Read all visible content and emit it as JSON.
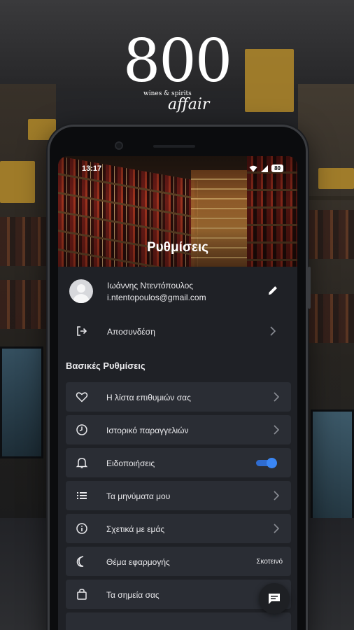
{
  "logo": {
    "number": "800",
    "subtitle": "wines & spirits",
    "script": "affair"
  },
  "status_bar": {
    "time": "13:17",
    "battery": "80"
  },
  "header": {
    "title": "Ρυθμίσεις"
  },
  "user": {
    "name": "Ιωάννης Ντεντόπουλος",
    "email": "i.ntentopoulos@gmail.com"
  },
  "logout": {
    "label": "Αποσυνδέση"
  },
  "settings": {
    "section_title": "Βασικές Ρυθμίσεις",
    "items": [
      {
        "label": "Η λίστα επιθυμιών σας",
        "icon": "heart-icon",
        "control": "chevron"
      },
      {
        "label": "Ιστορικό παραγγελιών",
        "icon": "clock-icon",
        "control": "chevron"
      },
      {
        "label": "Ειδοποιήσεις",
        "icon": "bell-icon",
        "control": "toggle",
        "toggle_on": true
      },
      {
        "label": "Τα μηνύματα μου",
        "icon": "list-icon",
        "control": "chevron"
      },
      {
        "label": "Σχετικά με εμάς",
        "icon": "info-icon",
        "control": "chevron"
      },
      {
        "label": "Θέμα εφαρμογής",
        "icon": "moon-icon",
        "control": "value",
        "value": "Σκοτεινό"
      },
      {
        "label": "Τα σημεία σας",
        "icon": "bag-icon",
        "control": "none"
      }
    ]
  },
  "colors": {
    "accent_toggle": "#3a86f4",
    "card_bg": "#2a2d34",
    "screen_bg": "#1f2126"
  }
}
